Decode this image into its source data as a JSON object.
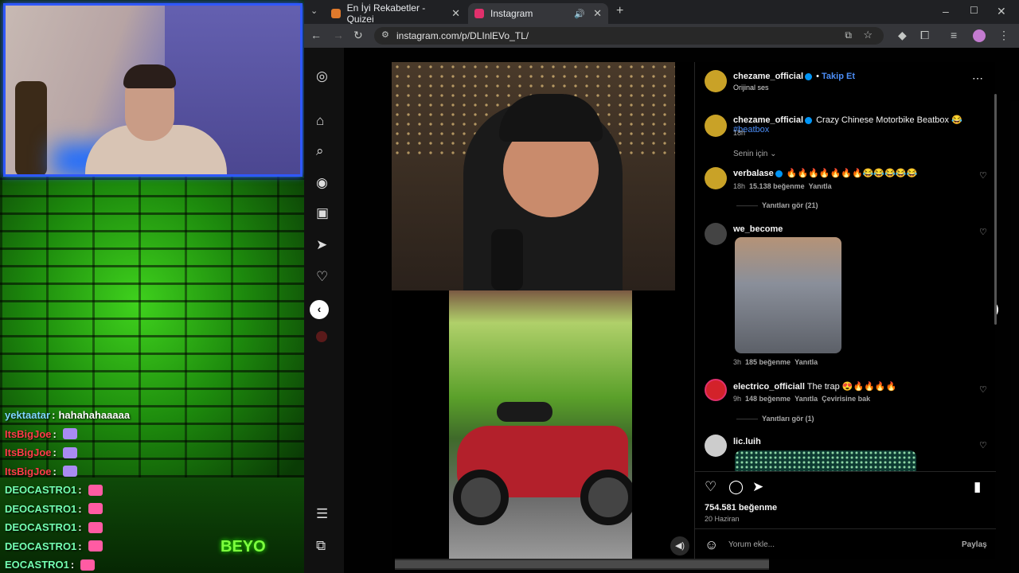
{
  "chat": [
    {
      "user": "yektaatar",
      "user_color": "#7fd7ff",
      "msg": "hahahahaaaaa"
    },
    {
      "user": "ItsBigJoe",
      "user_color": "#ff3b4a",
      "msg": "",
      "emote": "#a98bf2"
    },
    {
      "user": "ItsBigJoe",
      "user_color": "#ff3b4a",
      "msg": "",
      "emote": "#a98bf2"
    },
    {
      "user": "ItsBigJoe",
      "user_color": "#ff3b4a",
      "msg": "",
      "emote": "#a98bf2"
    },
    {
      "user": "DEOCASTRO1",
      "user_color": "#74ffb2",
      "msg": "",
      "emote": "#ff5ba3"
    },
    {
      "user": "DEOCASTRO1",
      "user_color": "#74ffb2",
      "msg": "",
      "emote": "#ff5ba3"
    },
    {
      "user": "DEOCASTRO1",
      "user_color": "#74ffb2",
      "msg": "",
      "emote": "#ff5ba3"
    },
    {
      "user": "DEOCASTRO1",
      "user_color": "#74ffb2",
      "msg": "",
      "emote": "#ff5ba3"
    },
    {
      "user": "EOCASTRO1",
      "user_color": "#74ffb2",
      "msg": "",
      "emote": "#ff5ba3"
    }
  ],
  "stream_logo": "BEYO",
  "browser": {
    "tabs": [
      {
        "label": "En İyi Rekabetler - Quizei",
        "icon": "quiz-favicon-icon",
        "color": "#e07a2c"
      },
      {
        "label": "Instagram",
        "icon": "instagram-favicon-icon",
        "color": "#e1306c"
      }
    ],
    "url": "instagram.com/p/DLInlEVo_TL/"
  },
  "post": {
    "author": "chezame_official",
    "follow": "Takip Et",
    "audio": "Orijinal ses",
    "caption": "Crazy Chinese Motorbike Beatbox 😂",
    "hashtag": "#beatbox",
    "caption_age": "18h",
    "filter": "Senin için",
    "likes": "754.581 beğenme",
    "date": "20 Haziran",
    "comment_placeholder": "Yorum ekle...",
    "share": "Paylaş"
  },
  "comments": [
    {
      "user": "verbalase",
      "verified": true,
      "text": "🔥🔥🔥🔥🔥🔥🔥😂😂😂😂😂",
      "age": "18h",
      "likes": "15.138 beğenme",
      "reply": "Yanıtla",
      "view_replies": "Yanıtları gör (21)",
      "avatar": "#c9a227"
    },
    {
      "user": "we_become",
      "text": "",
      "age": "3h",
      "likes": "185 beğenme",
      "reply": "Yanıtla",
      "avatar": "#555"
    },
    {
      "user": "electrico_officiall",
      "text": "The trap 😍🔥🔥🔥🔥",
      "age": "9h",
      "likes": "148 beğenme",
      "reply": "Yanıtla",
      "translate": "Çevirisine bak",
      "view_replies": "Yanıtları gör (1)",
      "avatar": "#d3222a"
    },
    {
      "user": "lic.luih",
      "avatar": "#ccc"
    }
  ]
}
